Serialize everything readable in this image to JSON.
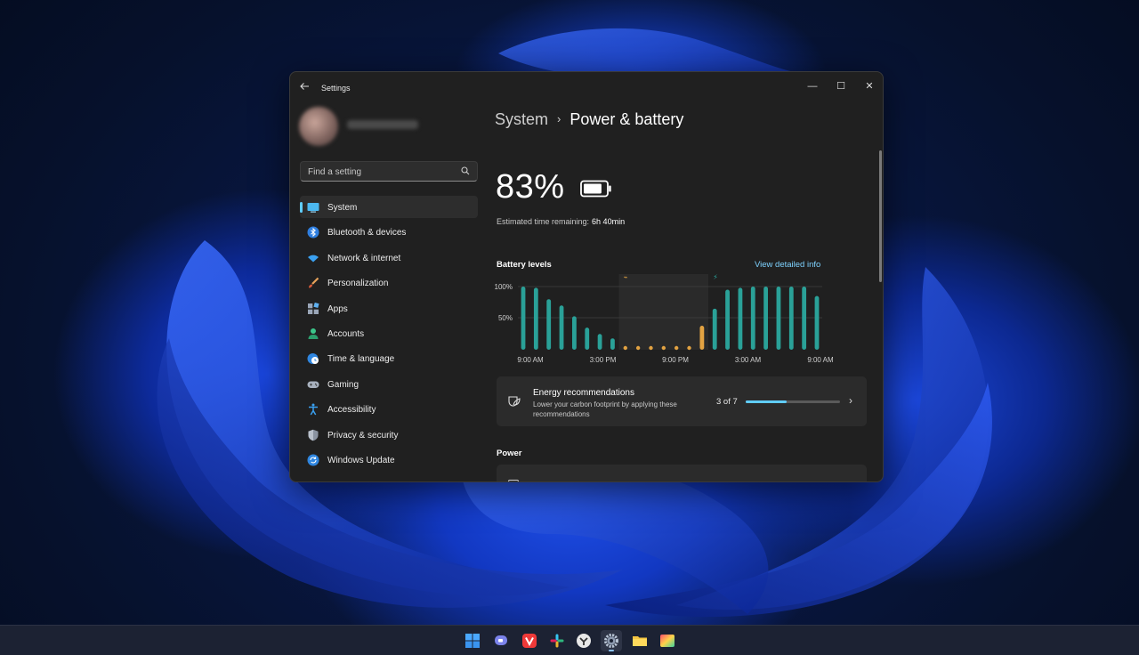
{
  "window": {
    "title": "Settings",
    "controls": {
      "minimize": "—",
      "maximize": "☐",
      "close": "✕"
    }
  },
  "search": {
    "placeholder": "Find a setting"
  },
  "sidebar": {
    "items": [
      {
        "label": "System",
        "icon": "monitor-icon",
        "active": true
      },
      {
        "label": "Bluetooth & devices",
        "icon": "bluetooth-icon"
      },
      {
        "label": "Network & internet",
        "icon": "wifi-icon"
      },
      {
        "label": "Personalization",
        "icon": "brush-icon"
      },
      {
        "label": "Apps",
        "icon": "apps-icon"
      },
      {
        "label": "Accounts",
        "icon": "person-icon"
      },
      {
        "label": "Time & language",
        "icon": "globe-clock-icon"
      },
      {
        "label": "Gaming",
        "icon": "gamepad-icon"
      },
      {
        "label": "Accessibility",
        "icon": "accessibility-icon"
      },
      {
        "label": "Privacy & security",
        "icon": "shield-icon"
      },
      {
        "label": "Windows Update",
        "icon": "update-icon"
      }
    ]
  },
  "breadcrumb": {
    "parent": "System",
    "separator": "›",
    "current": "Power & battery"
  },
  "battery": {
    "percent": "83%",
    "level": 0.83,
    "estimate_label": "Estimated time remaining:",
    "estimate_value": "6h 40min"
  },
  "battery_levels": {
    "title": "Battery levels",
    "link": "View detailed info"
  },
  "chart_data": {
    "type": "bar",
    "yticks": [
      "100%",
      "50%"
    ],
    "xticks": [
      "9:00 AM",
      "3:00 PM",
      "9:00 PM",
      "3:00 AM",
      "9:00 AM"
    ],
    "ylim": [
      0,
      100
    ],
    "colors": {
      "normal": "#2aa198",
      "saver": "#e3a342",
      "grid": "#3f3f3f",
      "shade": "#2a2a2a"
    },
    "values": [
      100,
      98,
      80,
      70,
      53,
      35,
      25,
      18,
      0,
      0,
      0,
      0,
      0,
      0,
      38,
      65,
      95,
      98,
      100,
      100,
      100,
      100,
      100,
      85
    ],
    "mode": [
      "n",
      "n",
      "n",
      "n",
      "n",
      "n",
      "n",
      "n",
      "s",
      "s",
      "s",
      "s",
      "s",
      "s",
      "s",
      "n",
      "n",
      "n",
      "n",
      "n",
      "n",
      "n",
      "n",
      "n"
    ]
  },
  "energy": {
    "title": "Energy recommendations",
    "subtitle": "Lower your carbon footprint by applying these recommendations",
    "count": "3 of 7",
    "progress": 0.43
  },
  "power": {
    "title": "Power"
  },
  "taskbar": {
    "items": [
      {
        "icon": "windows-start-icon"
      },
      {
        "icon": "teams-chat-icon"
      },
      {
        "icon": "vivaldi-icon"
      },
      {
        "icon": "slack-icon"
      },
      {
        "icon": "app-icon"
      },
      {
        "icon": "settings-gear-icon",
        "active": true
      },
      {
        "icon": "file-explorer-icon"
      },
      {
        "icon": "color-app-icon"
      }
    ]
  }
}
